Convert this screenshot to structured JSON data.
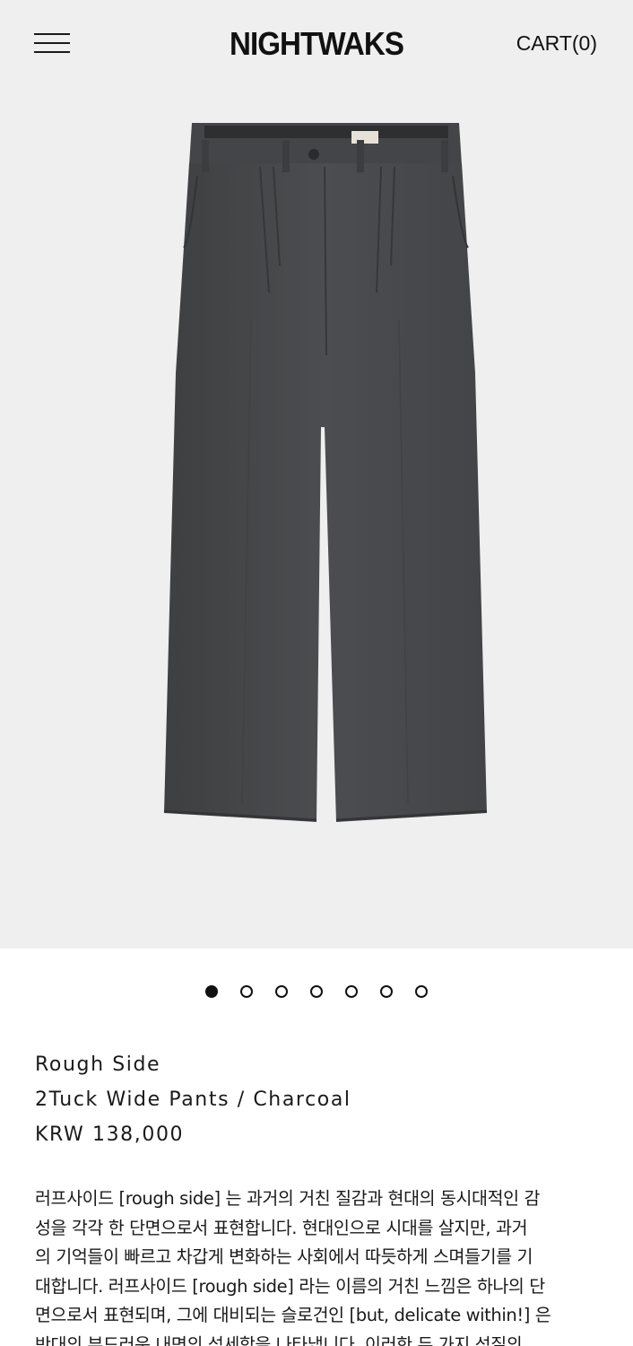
{
  "header": {
    "logo": "NIGHTWAKS",
    "cart_label": "CART(0)"
  },
  "hero": {
    "image_subject": "charcoal 2-tuck wide pants",
    "slide_count": 7,
    "active_slide": 1
  },
  "product": {
    "collection": "Rough Side",
    "name": "2Tuck Wide Pants / Charcoal",
    "price": "KRW 138,000"
  },
  "description": {
    "lines": [
      "러프사이드 [rough side] 는 과거의 거친 질감과 현대의 동시대적인 감",
      "성을 각각 한 단면으로서 표현합니다. 현대인으로 시대를 살지만, 과거",
      "의 기억들이 빠르고 차갑게 변화하는 사회에서 따듯하게 스며들기를 기",
      "대합니다. 러프사이드 [rough side] 라는 이름의 거친 느낌은 하나의 단",
      "면으로서 표현되며, 그에 대비되는 슬로건인 [but, delicate within!] 은",
      "반대의 부드러운 내면의 섬세함을 나타냅니다. 이러한 두 가지 성질의"
    ]
  },
  "colors": {
    "hero_bg": "#efefef",
    "pants": "#4a4b4d",
    "text": "#1a1a1a"
  }
}
